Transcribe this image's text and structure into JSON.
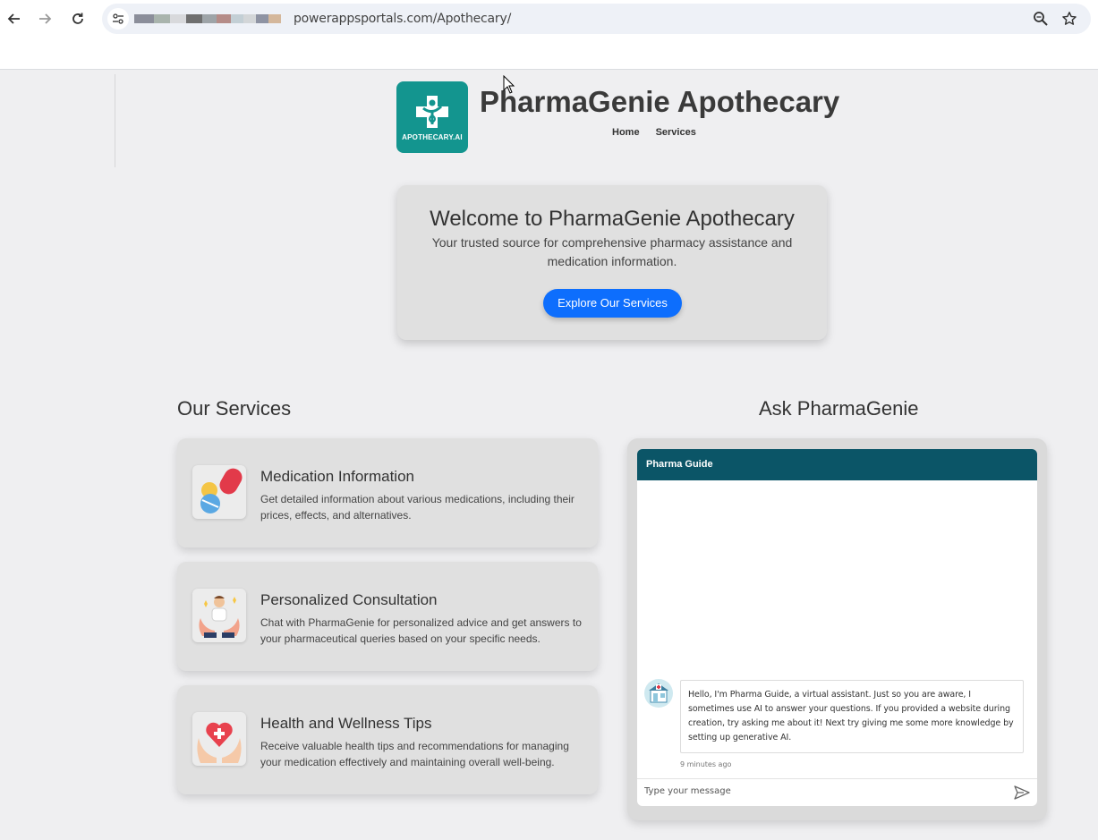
{
  "browser": {
    "url_visible": "powerappsportals.com/Apothecary/",
    "back_icon": "back-arrow-icon",
    "forward_icon": "forward-arrow-icon",
    "reload_icon": "reload-icon",
    "zoom_icon": "zoom-icon",
    "bookmark_icon": "star-icon"
  },
  "header": {
    "logo_text": "APOTHECARY.AI",
    "title": "PharmaGenie Apothecary",
    "nav": [
      "Home",
      "Services"
    ]
  },
  "hero": {
    "heading": "Welcome to PharmaGenie Apothecary",
    "subtitle": "Your trusted source for comprehensive pharmacy assistance and medication information.",
    "cta_label": "Explore Our Services"
  },
  "services": {
    "title": "Our Services",
    "items": [
      {
        "title": "Medication Information",
        "description": "Get detailed information about various medications, including their prices, effects, and alternatives.",
        "icon": "pills-icon"
      },
      {
        "title": "Personalized Consultation",
        "description": "Chat with PharmaGenie for personalized advice and get answers to your pharmaceutical queries based on your specific needs.",
        "icon": "consultation-icon"
      },
      {
        "title": "Health and Wellness Tips",
        "description": "Receive valuable health tips and recommendations for managing your medication effectively and maintaining overall well-being.",
        "icon": "heart-hands-icon"
      }
    ]
  },
  "chat": {
    "section_title": "Ask PharmaGenie",
    "header": "Pharma Guide",
    "bot_message": "Hello, I'm Pharma Guide, a virtual assistant. Just so you are aware, I sometimes use AI to answer your questions. If you provided a website during creation, try asking me about it! Next try giving me some more knowledge by setting up generative AI.",
    "timestamp": "9 minutes ago",
    "input_placeholder": "Type your message"
  },
  "colors": {
    "accent": "#0d6efd",
    "chat_header": "#0b5567",
    "logo_bg": "#13958f",
    "page_bg": "#efeff1"
  }
}
